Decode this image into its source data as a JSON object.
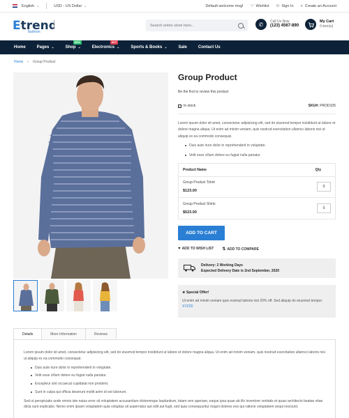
{
  "topbar": {
    "language": "English",
    "currency": "USD - US Dollar",
    "welcome": "Default welcome msg!",
    "wishlist": "Wishlist",
    "signin": "Sign In",
    "create_account": "Create an Account"
  },
  "header": {
    "logo_main": "Etrend",
    "logo_sub": "fashion",
    "search_placeholder": "Search entire store here...",
    "call_label": "Call Us Now",
    "call_number": "(123) 4567-890",
    "cart_label": "My Cart",
    "cart_items": "0 item(s)"
  },
  "nav": {
    "items": [
      {
        "label": "Home"
      },
      {
        "label": "Pages"
      },
      {
        "label": "Shop",
        "badge": "NEW"
      },
      {
        "label": "Electronics",
        "badge": "HOT"
      },
      {
        "label": "Sports & Books"
      },
      {
        "label": "Sale"
      },
      {
        "label": "Contact Us"
      }
    ]
  },
  "breadcrumb": {
    "home": "Home",
    "current": "Group Product"
  },
  "product": {
    "title": "Group Product",
    "review_link": "Be the first to review this product",
    "stock": "In stock",
    "sku_label": "SKU#:",
    "sku_value": "PROD105",
    "description": "Lorem ipsum dolor sit amet, consectetur adipisicing elit, sed do eiusmod tempor incididunt ut labore et dolore magna aliqua. Ut enim ad minim veniam, quis nostrud exercitation ullamco laboris nisi ut aliquip ex ea commodo consequat.",
    "bullets": [
      "Duis aute irure dolor in reprehenderit in voluptate.",
      "Velit esse cillum dolore eu fugiat nulla pariatur."
    ],
    "grouped_header": {
      "name": "Product Name",
      "qty": "Qty"
    },
    "grouped_items": [
      {
        "name": "Group Product Tshirt",
        "price": "$123.00",
        "qty": "0"
      },
      {
        "name": "Group Product Shirts",
        "price": "$523.00",
        "qty": "0"
      }
    ],
    "add_to_cart": "ADD TO CART",
    "add_to_wishlist": "ADD TO WISH LIST",
    "add_to_compare": "ADD TO COMPARE",
    "delivery_line1": "Delivery: 2 Working Days",
    "delivery_line2": "Expected Delivery Date is 2nd September, 2020",
    "special_title": "Special Offer!",
    "special_text": "Ut enim ad minim veniam quis nostrud laboris nisi 20% off. Sed aliquip do eiusmod tempor:",
    "special_code": "XYZ20"
  },
  "tabs": {
    "items": [
      "Details",
      "More Information",
      "Reviews"
    ],
    "details_p1": "Lorem ipsum dolor sit amet, consectetur adipisicing elit, sed do eiusmod tempor incididunt ut labore et dolore magna aliqua. Ut enim ad minim veniam, quis nostrud exercitation ullamco laboris nisi ut aliquip ex ea commodo consequat.",
    "details_bullets": [
      "Duis aute irure dolor in reprehenderit in voluptate.",
      "Velit esse cillum dolore eu fugiat nulla pariatur.",
      "Excepteur sint occaecat cupidatat non proident.",
      "Sunt in culpa qui officia deserunt mollit anim id est laborum."
    ],
    "details_p2": "Sed ut perspiciatis unde omnis iste natus error sit voluptatem accusantium doloremque laudantium, totam rem aperiam, eaque ipsa quae ab illo inventore veritatis et quasi architecto beatae vitae dicta sunt explicabo. Nemo enim ipsam voluptatem quia voluptas sit aspernatur aut odit aut fugit, sed quia consequuntur magni dolores eos qui ratione voluptatem sequi nesciunt."
  }
}
